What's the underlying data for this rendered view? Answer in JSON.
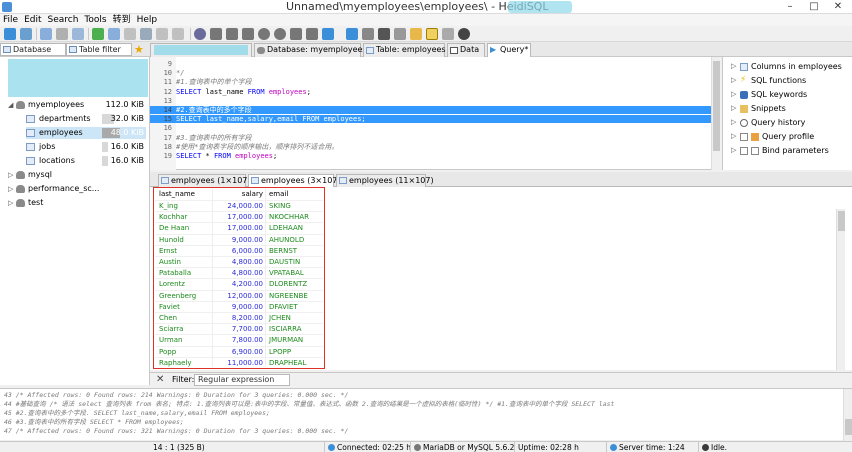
{
  "window": {
    "title": "Unnamed\\myemployees\\employees\\ - HeidiSQL"
  },
  "menu": [
    "File",
    "Edit",
    "Search",
    "Tools",
    "转到",
    "Help"
  ],
  "colors": {
    "selection": "#3399ff",
    "accent_red": "#e0302a",
    "blur": "#8fd8ea"
  },
  "left_filters": {
    "database": "Database filter",
    "table": "Table filter"
  },
  "main_tabs": [
    {
      "label": "Database: myemployees",
      "icon": "database-icon"
    },
    {
      "label": "Table: employees",
      "icon": "table-icon"
    },
    {
      "label": "Data",
      "icon": "grid-icon"
    },
    {
      "label": "Query*",
      "icon": "play-icon"
    }
  ],
  "tree": {
    "db": {
      "name": "myemployees",
      "size": "112.0 KiB"
    },
    "tables": [
      {
        "name": "departments",
        "size": "32.0 KiB",
        "fill": 0.29
      },
      {
        "name": "employees",
        "size": "48.0 KiB",
        "fill": 0.43,
        "selected": true
      },
      {
        "name": "jobs",
        "size": "16.0 KiB",
        "fill": 0.14
      },
      {
        "name": "locations",
        "size": "16.0 KiB",
        "fill": 0.14
      }
    ],
    "others": [
      "mysql",
      "performance_sc...",
      "test"
    ]
  },
  "editor_lines": [
    {
      "n": "9",
      "parts": []
    },
    {
      "n": "10",
      "parts": [
        {
          "c": "cm",
          "t": "*/"
        }
      ]
    },
    {
      "n": "11",
      "parts": [
        {
          "c": "cm",
          "t": "#1.查询表中的单个字段"
        }
      ]
    },
    {
      "n": "12",
      "parts": [
        {
          "c": "kw",
          "t": "SELECT "
        },
        {
          "c": "",
          "t": "last_name "
        },
        {
          "c": "kw",
          "t": "FROM "
        },
        {
          "c": "fn",
          "t": "employees"
        },
        {
          "c": "",
          "t": ";"
        }
      ]
    },
    {
      "n": "13",
      "parts": []
    },
    {
      "n": "14",
      "sel": true,
      "parts": [
        {
          "c": "",
          "t": "#2.查询表中的多个字段"
        }
      ]
    },
    {
      "n": "15",
      "sel": true,
      "parts": [
        {
          "c": "",
          "t": "SELECT last_name,salary,email FROM employees;"
        }
      ]
    },
    {
      "n": "16",
      "parts": []
    },
    {
      "n": "17",
      "parts": [
        {
          "c": "cm",
          "t": "#3.查询表中的所有字段"
        }
      ]
    },
    {
      "n": "18",
      "parts": [
        {
          "c": "cm",
          "t": "#使用*查询表字段的顺序输出，顺序排列不适合用。"
        }
      ]
    },
    {
      "n": "19",
      "parts": [
        {
          "c": "kw",
          "t": "SELECT "
        },
        {
          "c": "",
          "t": "* "
        },
        {
          "c": "kw",
          "t": "FROM "
        },
        {
          "c": "fn",
          "t": "employees"
        },
        {
          "c": "",
          "t": ";"
        }
      ]
    }
  ],
  "helpers": [
    {
      "label": "Columns in employees",
      "icon": "columns-icon"
    },
    {
      "label": "SQL functions",
      "icon": "lightning-icon"
    },
    {
      "label": "SQL keywords",
      "icon": "keyword-icon"
    },
    {
      "label": "Snippets",
      "icon": "folder-icon"
    },
    {
      "label": "Query history",
      "icon": "clock-icon"
    },
    {
      "label": "Query profile",
      "icon": "checkbox-icon"
    },
    {
      "label": "Bind parameters",
      "icon": "checkbox-icon"
    }
  ],
  "result_tabs": [
    {
      "label": "employees (1×107)"
    },
    {
      "label": "employees (3×107)",
      "active": true
    },
    {
      "label": "employees (11×107)"
    }
  ],
  "grid": {
    "columns": [
      "last_name",
      "salary",
      "email"
    ],
    "rows": [
      [
        "K_ing",
        "24,000.00",
        "SKING"
      ],
      [
        "Kochhar",
        "17,000.00",
        "NKOCHHAR"
      ],
      [
        "De Haan",
        "17,000.00",
        "LDEHAAN"
      ],
      [
        "Hunold",
        "9,000.00",
        "AHUNOLD"
      ],
      [
        "Ernst",
        "6,000.00",
        "BERNST"
      ],
      [
        "Austin",
        "4,800.00",
        "DAUSTIN"
      ],
      [
        "Pataballa",
        "4,800.00",
        "VPATABAL"
      ],
      [
        "Lorentz",
        "4,200.00",
        "DLORENTZ"
      ],
      [
        "Greenberg",
        "12,000.00",
        "NGREENBE"
      ],
      [
        "Faviet",
        "9,000.00",
        "DFAVIET"
      ],
      [
        "Chen",
        "8,200.00",
        "JCHEN"
      ],
      [
        "Sciarra",
        "7,700.00",
        "ISCIARRA"
      ],
      [
        "Urman",
        "7,800.00",
        "JMURMAN"
      ],
      [
        "Popp",
        "6,900.00",
        "LPOPP"
      ],
      [
        "Raphaely",
        "11,000.00",
        "DRAPHEAL"
      ]
    ]
  },
  "filter": {
    "label": "Filter:",
    "placeholder": "Regular expression"
  },
  "log": [
    "43 /* Affected rows: 0  Found rows: 214  Warnings: 0  Duration for 3 queries: 0.000 sec. */",
    "44 #基础查询  /*  语法  select 查询列表  from 表名;   特点: 1.查询列表可以是:表中的字段、常量值、表达式、函数  2.查询的结果是一个虚拟的表格(临时性)   */  #1.查询表中的单个字段  SELECT last",
    "45 #2.查询表中的多个字段.  SELECT last_name,salary,email FROM employees;",
    "46 #3.查询表中的所有字段  SELECT * FROM employees;",
    "47 /* Affected rows: 0  Found rows: 321  Warnings: 0  Duration for 3 queries: 0.000 sec. */"
  ],
  "status": {
    "position": "14 : 1 (325 B)",
    "connected": "Connected: 02:25 h",
    "server": "MariaDB or MySQL 5.6.22",
    "uptime": "Uptime: 02:28 h",
    "server_time": "Server time: 1:24",
    "state": "Idle."
  }
}
